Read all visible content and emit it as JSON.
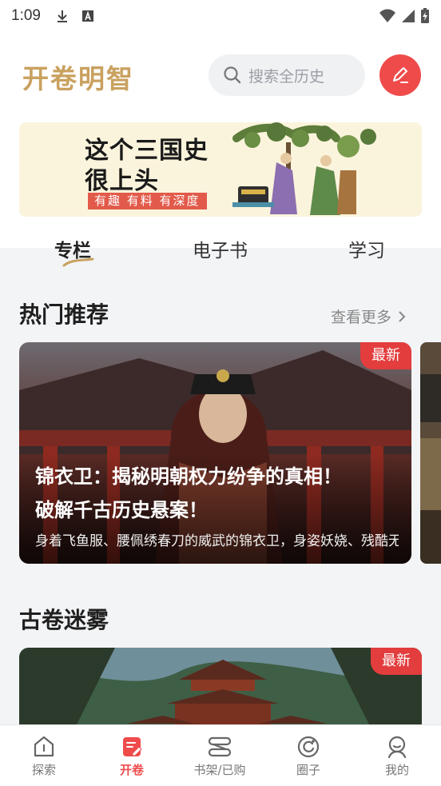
{
  "status_bar": {
    "time": "1:09"
  },
  "header": {
    "logo": "开卷明智",
    "search_placeholder": "搜索全历史"
  },
  "banner": {
    "line1": "这个三国史",
    "line2": "很上头",
    "tag": "有趣 有料 有深度"
  },
  "tabs": [
    {
      "label": "专栏",
      "active": true
    },
    {
      "label": "电子书",
      "active": false
    },
    {
      "label": "学习",
      "active": false
    }
  ],
  "hot": {
    "title": "热门推荐",
    "more": "查看更多",
    "card": {
      "badge": "最新",
      "title_line1": "锦衣卫：揭秘明朝权力纷争的真相！",
      "title_line2": "破解千古历史悬案！",
      "desc": "身着飞鱼服、腰佩绣春刀的威武的锦衣卫，身姿妖娆、残酷无情的东厂督公……"
    }
  },
  "ancient": {
    "title": "古卷迷雾",
    "card": {
      "badge": "最新"
    }
  },
  "bottom_nav": [
    {
      "label": "探索",
      "icon": "explore-icon",
      "active": false
    },
    {
      "label": "开卷",
      "icon": "open-book-icon",
      "active": true
    },
    {
      "label": "书架/已购",
      "icon": "bookshelf-icon",
      "active": false
    },
    {
      "label": "圈子",
      "icon": "circle-icon",
      "active": false
    },
    {
      "label": "我的",
      "icon": "profile-icon",
      "active": false
    }
  ],
  "colors": {
    "accent": "#ef4b4b",
    "logo": "#c9a15f",
    "badge": "#e33d3d"
  }
}
